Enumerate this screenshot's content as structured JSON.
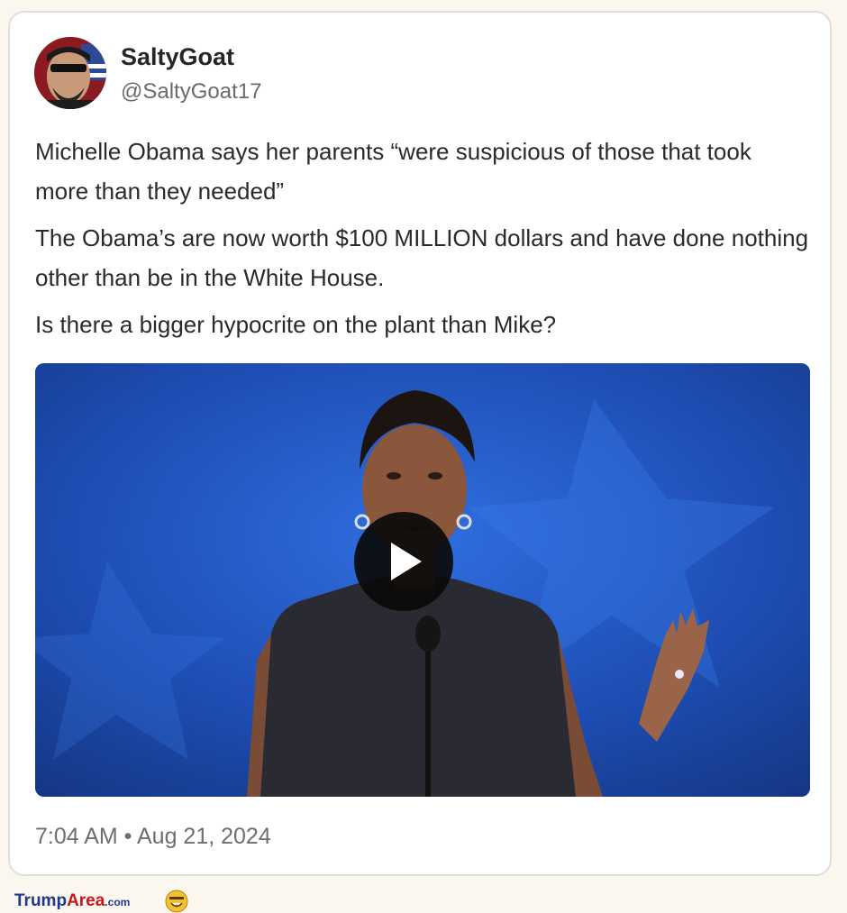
{
  "tweet": {
    "author": {
      "display_name": "SaltyGoat",
      "handle": "@SaltyGoat17"
    },
    "paragraphs": [
      "Michelle Obama says her parents “were suspicious of those that took more than they needed”",
      "The Obama’s are now worth $100 MILLION dollars and have done nothing other than be in the White House.",
      "Is there a bigger hypocrite on the plant than Mike?"
    ],
    "media": {
      "type": "video",
      "play_icon": "play-icon"
    },
    "timestamp": "7:04 AM • Aug 21, 2024"
  },
  "watermark": {
    "part1": "Trump",
    "part2": "Area",
    "part3": ".com",
    "icon": "smiley-face-icon"
  },
  "colors": {
    "card_background": "#ffffff",
    "page_background": "#fbf7ef",
    "video_background": "#1a3f9a",
    "logo_blue": "#1c3a8a",
    "logo_red": "#c8161d"
  }
}
